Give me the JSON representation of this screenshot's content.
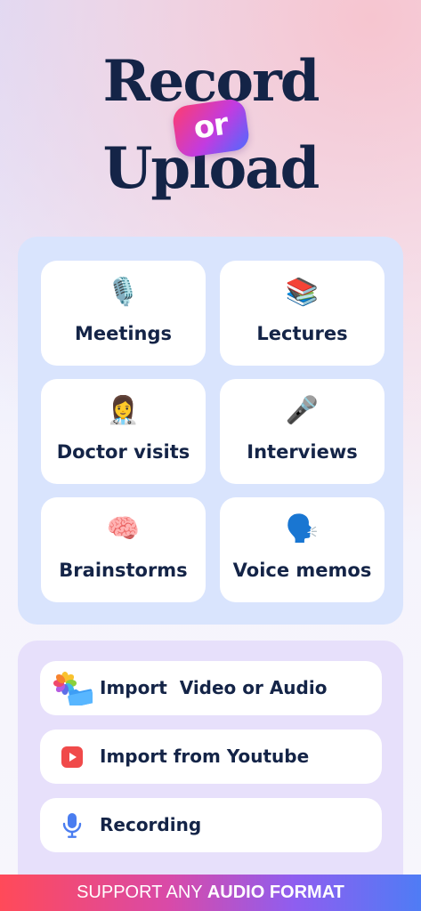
{
  "hero": {
    "line1": "Record",
    "connector": "or",
    "line2": "Upload"
  },
  "categories": [
    {
      "label": "Meetings",
      "emoji": "🎙️",
      "icon": "studio-microphone-icon"
    },
    {
      "label": "Lectures",
      "emoji": "📚",
      "icon": "books-icon"
    },
    {
      "label": "Doctor visits",
      "emoji": "👩‍⚕️",
      "icon": "doctor-icon"
    },
    {
      "label": "Interviews",
      "emoji": "🎤",
      "icon": "microphone-icon"
    },
    {
      "label": "Brainstorms",
      "emoji": "🧠",
      "icon": "brain-icon"
    },
    {
      "label": "Voice memos",
      "emoji": "🗣️",
      "icon": "speaking-head-icon"
    }
  ],
  "imports": [
    {
      "label": "Import  Video or Audio",
      "icon": "photos-folder-icon"
    },
    {
      "label": "Import from Youtube",
      "icon": "youtube-play-icon"
    },
    {
      "label": "Recording",
      "icon": "microphone-icon"
    }
  ],
  "banner": {
    "prefix": "SUPPORT ANY ",
    "highlight": "AUDIO FORMAT"
  },
  "colors": {
    "text": "#142447",
    "category_panel": "#d9e4fd",
    "import_panel": "#e7e0fb",
    "youtube_red": "#f04a4a",
    "mic_blue": "#4a7df0"
  }
}
